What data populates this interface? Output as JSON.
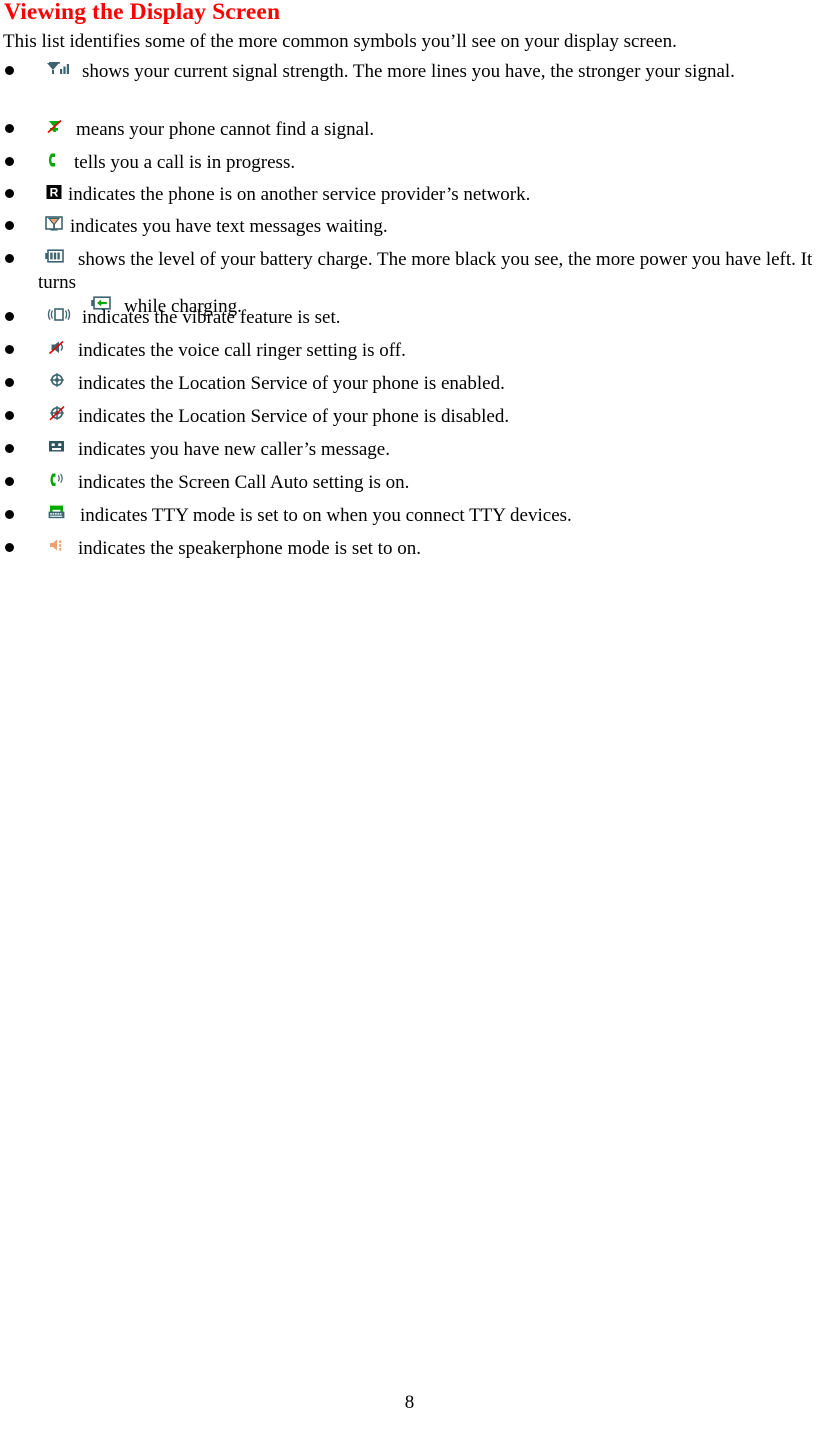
{
  "page": {
    "title": "Viewing the Display Screen",
    "intro": "This list identifies some of the more common symbols you’ll see on your display screen.",
    "page_number": "8",
    "title_color": "#ff0000",
    "text_color": "#000000",
    "icon_colors": {
      "slate": "#2f5560",
      "green": "#00a000",
      "red": "#e60000",
      "orange": "#f0a070",
      "black": "#000000",
      "white": "#ffffff"
    }
  },
  "items": [
    {
      "icon": "signal-strength-icon",
      "text": "shows your current signal strength. The more lines you have, the stronger your signal."
    },
    {
      "icon": "no-signal-icon",
      "text": "means your phone cannot find a signal."
    },
    {
      "icon": "call-in-progress-icon",
      "text": "tells you a call is in progress."
    },
    {
      "icon": "roaming-icon",
      "text": "indicates the phone is on another service provider’s network."
    },
    {
      "icon": "text-message-icon",
      "text": "indicates you have text messages waiting."
    },
    {
      "icon": "battery-level-icon",
      "text": "shows the level of your battery charge. The more black you see, the more power you have left. It turns",
      "text_after": "while charging.",
      "inline_icon": "battery-charging-icon"
    },
    {
      "icon": "vibrate-icon",
      "text": "indicates the vibrate feature is set."
    },
    {
      "icon": "ringer-off-icon",
      "text": "indicates the voice call ringer setting is off."
    },
    {
      "icon": "location-enabled-icon",
      "text": "indicates the Location Service of your phone is enabled."
    },
    {
      "icon": "location-disabled-icon",
      "text": "indicates the Location Service of your phone is disabled."
    },
    {
      "icon": "caller-message-icon",
      "text": "indicates you have new caller’s message."
    },
    {
      "icon": "screen-call-auto-icon",
      "text": "indicates the Screen Call Auto setting is on."
    },
    {
      "icon": "tty-mode-icon",
      "text": "indicates TTY mode is set to on when you connect TTY devices."
    },
    {
      "icon": "speakerphone-icon",
      "text": "indicates the speakerphone mode is set to on."
    }
  ]
}
